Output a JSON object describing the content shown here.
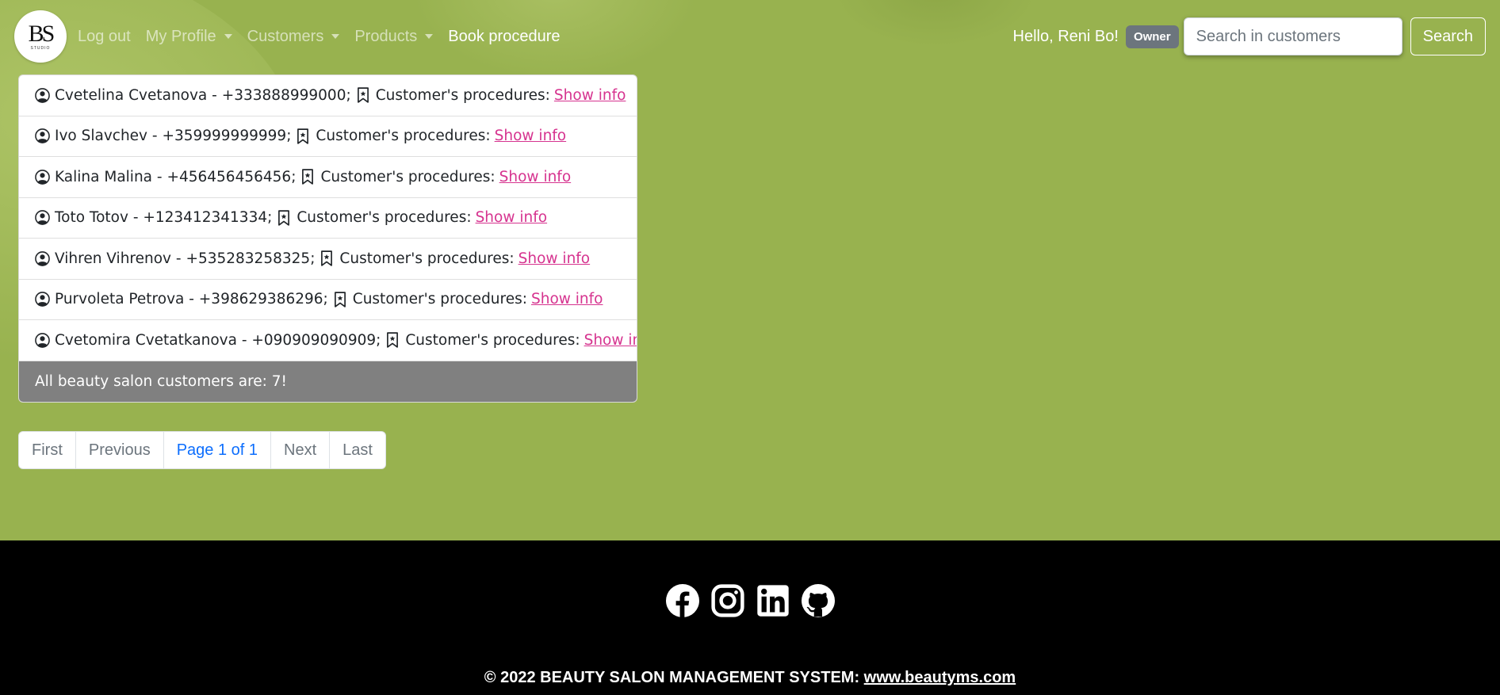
{
  "brand": {
    "monogram": "BS",
    "subtitle": "STUDIO"
  },
  "nav": {
    "logout": "Log out",
    "my_profile": "My Profile",
    "customers": "Customers",
    "products": "Products",
    "book_procedure": "Book procedure"
  },
  "user": {
    "greeting": "Hello, Reni Bo!",
    "role_badge": "Owner"
  },
  "search": {
    "placeholder": "Search in customers",
    "button": "Search"
  },
  "customers": [
    {
      "name": "Cvetelina Cvetanova",
      "phone": "+333888999000",
      "procedures_label": "Customer's procedures:",
      "link": "Show info"
    },
    {
      "name": "Ivo Slavchev",
      "phone": "+359999999999",
      "procedures_label": "Customer's procedures:",
      "link": "Show info"
    },
    {
      "name": "Kalina Malina",
      "phone": "+456456456456",
      "procedures_label": "Customer's procedures:",
      "link": "Show info"
    },
    {
      "name": "Toto Totov",
      "phone": "+123412341334",
      "procedures_label": "Customer's procedures:",
      "link": "Show info"
    },
    {
      "name": "Vihren Vihrenov",
      "phone": "+535283258325",
      "procedures_label": "Customer's procedures:",
      "link": "Show info"
    },
    {
      "name": "Purvoleta Petrova",
      "phone": "+398629386296",
      "procedures_label": "Customer's procedures:",
      "link": "Show info"
    },
    {
      "name": "Cvetomira Cvetatkanova",
      "phone": "+090909090909",
      "procedures_label": "Customer's procedures:",
      "link": "Show info"
    }
  ],
  "summary": "All beauty salon customers are: 7!",
  "pagination": {
    "first": "First",
    "previous": "Previous",
    "current": "Page 1 of 1",
    "next": "Next",
    "last": "Last"
  },
  "social": [
    "facebook-icon",
    "instagram-icon",
    "linkedin-icon",
    "github-icon"
  ],
  "footer": {
    "copyright": "© 2022 BEAUTY SALON MANAGEMENT SYSTEM:",
    "link": "www.beautyms.com"
  },
  "colors": {
    "background": "#98b24f",
    "link_pink": "#d6338f",
    "badge": "#6c757d",
    "summary_bg": "#808080",
    "footer_bg": "#000000"
  }
}
